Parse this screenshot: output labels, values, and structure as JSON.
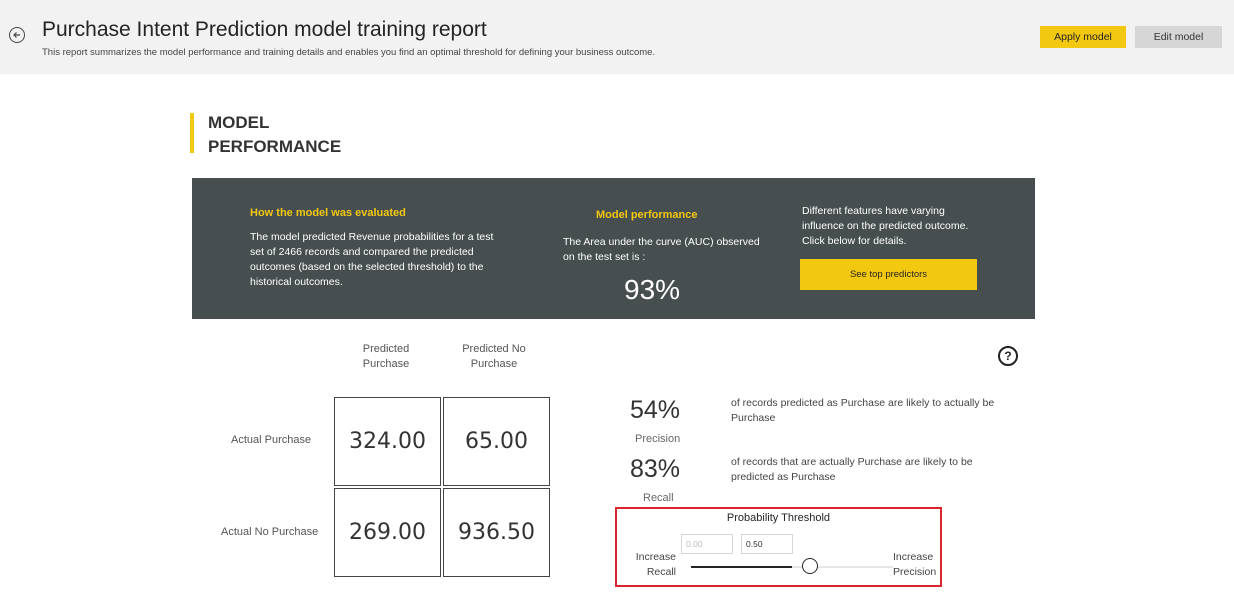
{
  "header": {
    "title": "Purchase Intent Prediction model training report",
    "subtitle": "This report summarizes the model performance and training details and enables you find an optimal threshold for defining your business outcome.",
    "apply_label": "Apply model",
    "edit_label": "Edit model",
    "back_icon": "back-arrow-icon"
  },
  "section": {
    "title": "MODEL PERFORMANCE",
    "accent_color": "#f2c811"
  },
  "panel": {
    "background": "#474e4f",
    "evaluated_heading": "How the model was evaluated",
    "evaluated_text": "The model predicted Revenue probabilities for a test set of 2466 records and compared the predicted outcomes (based on the selected threshold) to the historical outcomes.",
    "performance_heading": "Model performance",
    "performance_text": "The Area under the curve (AUC) observed on the test set is :",
    "auc_value": "93%",
    "features_text": "Different features have varying influence on the predicted outcome.  Click below for details.",
    "predictors_button": "See top predictors"
  },
  "matrix": {
    "col_headers": [
      "Predicted Purchase",
      "Predicted No Purchase"
    ],
    "row_headers": [
      "Actual Purchase",
      "Actual No Purchase"
    ],
    "cells": [
      [
        "324.00",
        "65.00"
      ],
      [
        "269.00",
        "936.50"
      ]
    ]
  },
  "metrics": {
    "precision_value": "54%",
    "precision_label": "Precision",
    "precision_desc": "of records predicted as Purchase are likely to actually be Purchase",
    "recall_value": "83%",
    "recall_label": "Recall",
    "recall_desc": "of records that are actually Purchase are likely to be predicted as Purchase"
  },
  "threshold": {
    "title": "Probability Threshold",
    "min_value": "0.00",
    "current_value": "0.50",
    "slider_fraction": 0.5,
    "left_label": "Increase Recall",
    "right_label": "Increase Precision",
    "highlight_color": "#d9262e"
  },
  "help_icon": "help-circle-icon"
}
